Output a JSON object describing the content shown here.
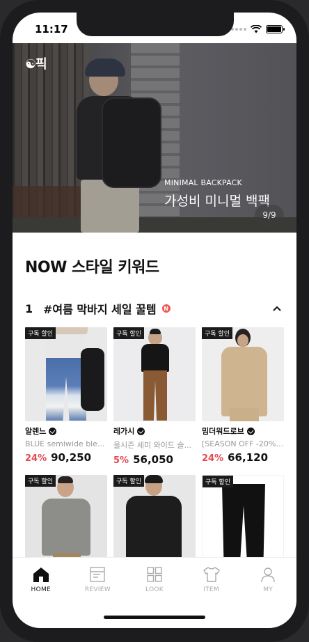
{
  "status": {
    "time": "11:17"
  },
  "hero": {
    "logo": "☯픽",
    "subtitle": "MINIMAL BACKPACK",
    "title": "가성비 미니멀 백팩",
    "page": "9/9"
  },
  "section": {
    "title": "NOW 스타일 키워드",
    "keyword": {
      "rank": "1",
      "text": "#여름 막바지 세일 꿀템",
      "new_badge": "N"
    }
  },
  "products": [
    {
      "badge": "구독 할인",
      "brand": "알렌느",
      "name": "BLUE semiwide ble...",
      "discount": "24%",
      "price": "90,250"
    },
    {
      "badge": "구독 할인",
      "brand": "레가시",
      "name": "올시즌 세미 와이드 슬...",
      "discount": "5%",
      "price": "56,050"
    },
    {
      "badge": "구독 할인",
      "brand": "밈더워드로브",
      "name": "[SEASON OFF -20%]...",
      "discount": "24%",
      "price": "66,120"
    },
    {
      "badge": "구독 할인"
    },
    {
      "badge": "구독 할인"
    },
    {
      "badge": "구독 할인"
    }
  ],
  "tabs": [
    {
      "label": "HOME",
      "icon": "home-icon",
      "active": true
    },
    {
      "label": "REVIEW",
      "icon": "review-icon"
    },
    {
      "label": "LOOK",
      "icon": "grid-icon"
    },
    {
      "label": "ITEM",
      "icon": "tshirt-icon"
    },
    {
      "label": "MY",
      "icon": "person-icon"
    }
  ],
  "colors": {
    "accent": "#e64852",
    "badge": "#1b1b1b"
  }
}
